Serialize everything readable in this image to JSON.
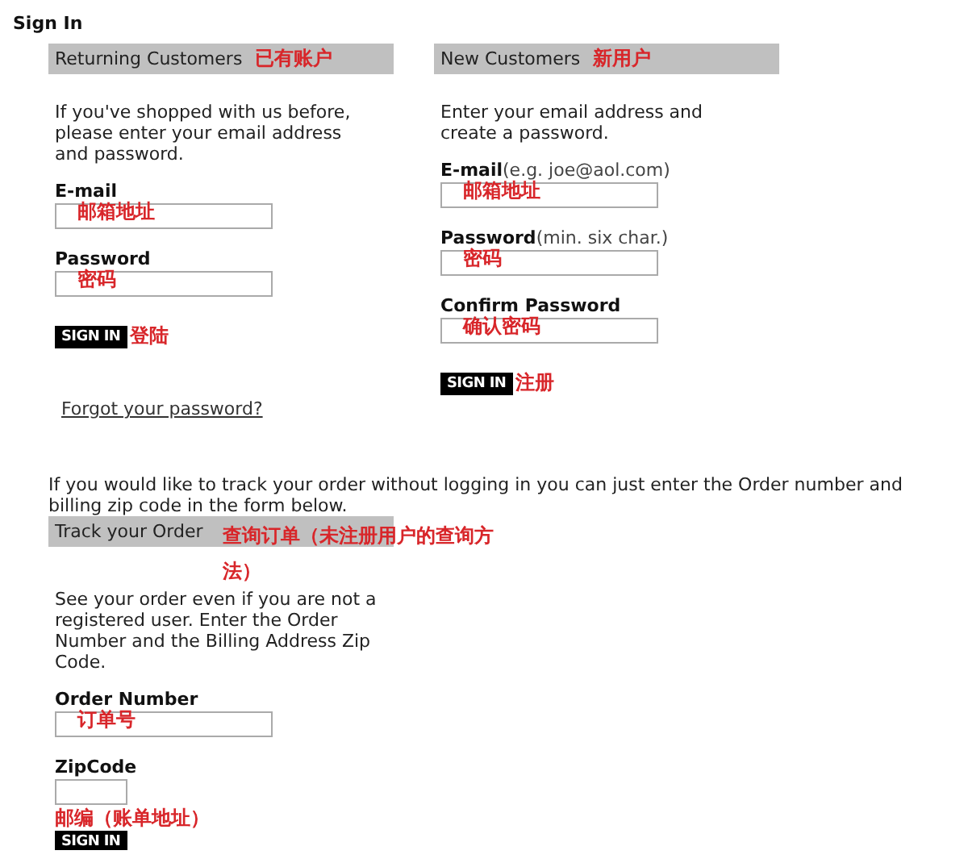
{
  "title": "Sign In",
  "returning": {
    "heading": "Returning Customers",
    "note": "已有账户",
    "intro": "If you've shopped with us before, please enter your email address and password.",
    "fields": [
      {
        "label": "E-mail",
        "note": "邮箱地址"
      },
      {
        "label": "Password",
        "note": "密码"
      }
    ],
    "button": "SIGN IN",
    "button_note": "登陆",
    "link": "Forgot your password?"
  },
  "new": {
    "heading": "New Customers",
    "note": "新用户",
    "intro": "Enter your email address and create a password.",
    "fields": [
      {
        "label": "E-mail",
        "hint": "(e.g. joe@aol.com)",
        "note": "邮箱地址"
      },
      {
        "label": "Password",
        "hint": "(min. six char.)",
        "note": "密码"
      },
      {
        "label": "Confirm Password",
        "note": "确认密码"
      }
    ],
    "button": "SIGN IN",
    "button_note": "注册"
  },
  "track_intro": "If you would like to track your order without logging in you can just enter the Order number and billing zip code in the form below.",
  "track": {
    "heading": "Track your Order",
    "note": "查询订单（未注册用户的查询方法）",
    "intro": "See your order even if you are not a registered user.  Enter the Order Number and the Billing Address Zip Code.",
    "fields": [
      {
        "label": "Order Number",
        "kind": "number",
        "note": "订单号"
      },
      {
        "label": "ZipCode",
        "kind": "zip",
        "note": "邮编（账单地址）"
      }
    ],
    "button": "SIGN IN"
  }
}
